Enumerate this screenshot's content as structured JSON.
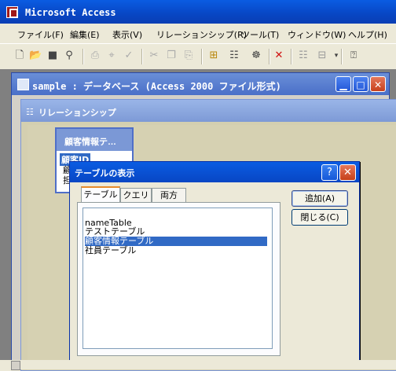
{
  "app": {
    "title": "Microsoft Access"
  },
  "menu": [
    "ファイル(F)",
    "編集(E)",
    "表示(V)",
    "リレーションシップ(R)",
    "ツール(T)",
    "ウィンドウ(W)",
    "ヘルプ(H)"
  ],
  "toolbar": {
    "icons": [
      "new-icon",
      "open-icon",
      "save-icon",
      "search-icon",
      "print-icon",
      "print-preview-icon",
      "spelling-icon",
      "cut-icon",
      "copy-icon",
      "paste-icon",
      "show-table-icon",
      "show-direct-icon",
      "show-all-icon",
      "delete-icon",
      "database-window-icon",
      "new-object-icon",
      "help-icon"
    ]
  },
  "db_window": {
    "title": "sample : データベース (Access 2000 ファイル形式)"
  },
  "relationships_window": {
    "title": "リレーションシップ"
  },
  "table_box": {
    "title": "顧客情報テ…",
    "fields": [
      "顧客ID",
      "顧",
      "担"
    ]
  },
  "dialog": {
    "title": "テーブルの表示",
    "tabs": [
      "テーブル",
      "クエリ",
      "両方"
    ],
    "active_tab": "テーブル",
    "list_items": [
      "nameTable",
      "テストテーブル",
      "顧客情報テーブル",
      "社員テーブル"
    ],
    "selected_item": "顧客情報テーブル",
    "buttons": {
      "add": "追加(A)",
      "close": "閉じる(C)"
    }
  },
  "colors": {
    "title_bar": "#0a5ce2",
    "selection": "#316ac5",
    "inactive_title": "#7d9ad6"
  }
}
